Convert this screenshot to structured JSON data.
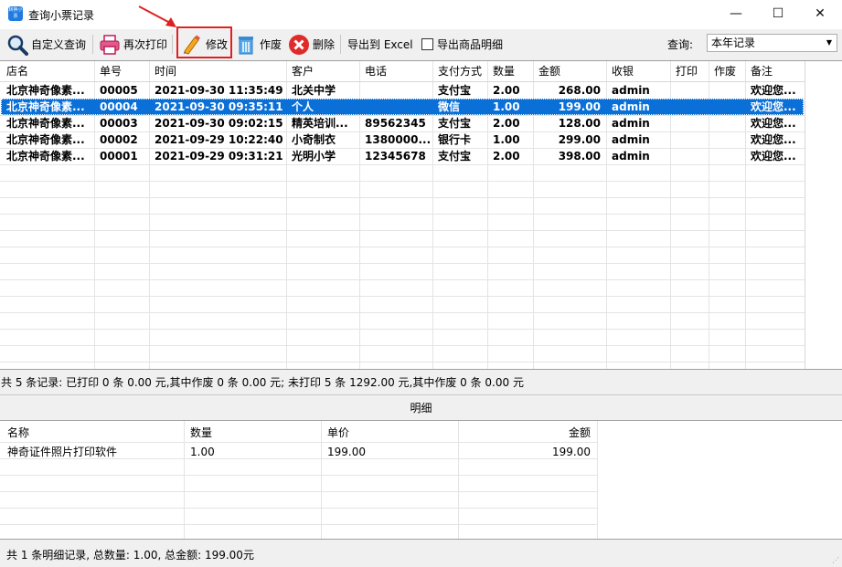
{
  "window": {
    "title": "查询小票记录",
    "icon_text": "转换小票",
    "controls": [
      "—",
      "☐",
      "✕"
    ]
  },
  "toolbar": {
    "custom_query": "自定义查询",
    "reprint": "再次打印",
    "modify": "修改",
    "void": "作废",
    "delete": "删除",
    "export_excel": "导出到 Excel",
    "export_detail": "导出商品明细",
    "query_label": "查询:",
    "query_value": "本年记录"
  },
  "table": {
    "headers": [
      "店名",
      "单号",
      "时间",
      "客户",
      "电话",
      "支付方式",
      "数量",
      "金额",
      "收银",
      "打印",
      "作废",
      "备注"
    ],
    "rows": [
      [
        "北京神奇像素...",
        "00005",
        "2021-09-30 11:35:49",
        "北关中学",
        "",
        "支付宝",
        "2.00",
        "268.00",
        "admin",
        "",
        "",
        "欢迎您..."
      ],
      [
        "北京神奇像素...",
        "00004",
        "2021-09-30 09:35:11",
        "个人",
        "",
        "微信",
        "1.00",
        "199.00",
        "admin",
        "",
        "",
        "欢迎您..."
      ],
      [
        "北京神奇像素...",
        "00003",
        "2021-09-30 09:02:15",
        "精英培训...",
        "89562345",
        "支付宝",
        "2.00",
        "128.00",
        "admin",
        "",
        "",
        "欢迎您..."
      ],
      [
        "北京神奇像素...",
        "00002",
        "2021-09-29 10:22:40",
        "小奇制衣",
        "1380000...",
        "银行卡",
        "1.00",
        "299.00",
        "admin",
        "",
        "",
        "欢迎您..."
      ],
      [
        "北京神奇像素...",
        "00001",
        "2021-09-29 09:31:21",
        "光明小学",
        "12345678",
        "支付宝",
        "2.00",
        "398.00",
        "admin",
        "",
        "",
        "欢迎您..."
      ]
    ],
    "selected_row": 1
  },
  "summary": "共 5 条记录:  已打印 0 条 0.00 元,其中作废 0 条 0.00 元;  未打印 5 条 1292.00 元,其中作废 0 条 0.00 元",
  "detail": {
    "title": "明细",
    "headers": [
      "名称",
      "数量",
      "单价",
      "金额"
    ],
    "rows": [
      [
        "神奇证件照片打印软件",
        "1.00",
        "199.00",
        "199.00"
      ]
    ]
  },
  "status": "共 1 条明细记录, 总数量: 1.00, 总金额: 199.00元",
  "colors": {
    "selection": "#0a6fd6",
    "highlight_box": "#e02020",
    "annotation_arrow": "#e02020"
  }
}
